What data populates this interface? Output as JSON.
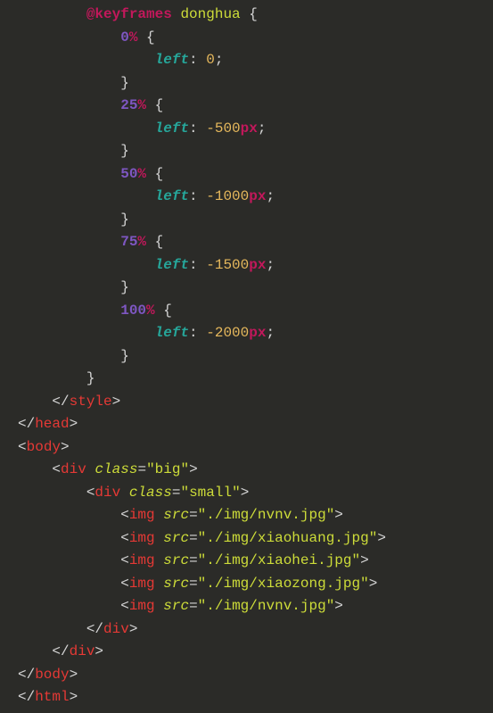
{
  "code": {
    "keyframes": {
      "atRule": "@keyframes",
      "name": "donghua",
      "frames": [
        {
          "percent": "0",
          "left_num": "0",
          "left_unit": ""
        },
        {
          "percent": "25",
          "left_num": "-500",
          "left_unit": "px"
        },
        {
          "percent": "50",
          "left_num": "-1000",
          "left_unit": "px"
        },
        {
          "percent": "75",
          "left_num": "-1500",
          "left_unit": "px"
        },
        {
          "percent": "100",
          "left_num": "-2000",
          "left_unit": "px"
        }
      ],
      "prop": "left"
    },
    "tags": {
      "style": "style",
      "head": "head",
      "body": "body",
      "div": "div",
      "img": "img",
      "html": "html"
    },
    "attrs": {
      "class": "class",
      "src": "src"
    },
    "values": {
      "big": "\"big\"",
      "small": "\"small\"",
      "img1": "\"./img/nvnv.jpg\"",
      "img2": "\"./img/xiaohuang.jpg\"",
      "img3": "\"./img/xiaohei.jpg\"",
      "img4": "\"./img/xiaozong.jpg\"",
      "img5": "\"./img/nvnv.jpg\""
    },
    "percent_sign": "%"
  }
}
